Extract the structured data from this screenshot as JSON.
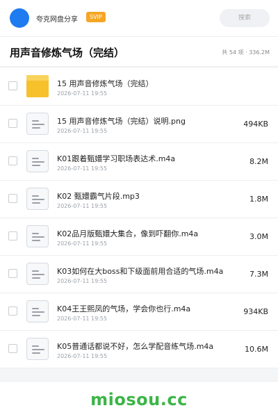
{
  "topbar": {
    "app_name": "夸克网盘分享",
    "badge": "SVIP",
    "search_placeholder": "搜索"
  },
  "folder": {
    "title": "用声音修炼气场（完结）",
    "summary": "共 54 项 · 336.2M"
  },
  "files": [
    {
      "name": "15 用声音修炼气场（完结）",
      "date": "2026-07-11 19:55",
      "size": "",
      "type": "folder"
    },
    {
      "name": "15 用声音修炼气场（完结）说明.png",
      "date": "2026-07-11 19:55",
      "size": "494KB",
      "type": "file"
    },
    {
      "name": "K01跟着甄嬛学习职场表达术.m4a",
      "date": "2026-07-11 19:55",
      "size": "8.2M",
      "type": "file"
    },
    {
      "name": "K02 甄嬛霸气片段.mp3",
      "date": "2026-07-11 19:55",
      "size": "1.8M",
      "type": "file"
    },
    {
      "name": "K02品月版甄嬛大集合，像到吓翻你.m4a",
      "date": "2026-07-11 19:55",
      "size": "3.0M",
      "type": "file"
    },
    {
      "name": "K03如何在大boss和下级面前用合适的气场.m4a",
      "date": "2026-07-11 19:55",
      "size": "7.3M",
      "type": "file"
    },
    {
      "name": "K04王王熙凤的气场，学会你也行.m4a",
      "date": "2026-07-11 19:55",
      "size": "934KB",
      "type": "file"
    },
    {
      "name": "K05普通话都说不好，怎么学配音练气场.m4a",
      "date": "2026-07-11 19:55",
      "size": "10.6M",
      "type": "file"
    }
  ],
  "watermark": "miosou.cc",
  "colors": {
    "brand_blue": "#1e7bf0",
    "svip_orange": "#f5a623",
    "folder_yellow": "#f6c12b",
    "watermark_green": "#3cb548"
  }
}
